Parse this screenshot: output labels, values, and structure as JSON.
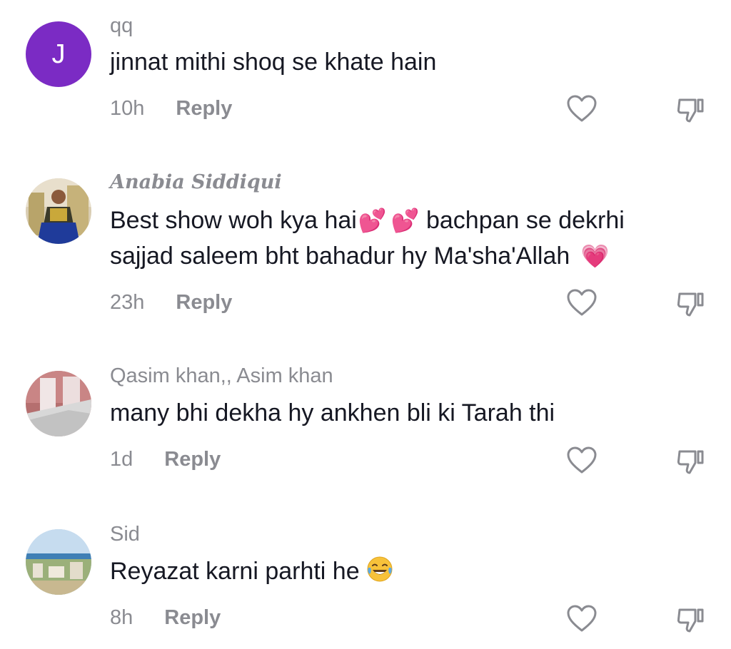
{
  "comments": [
    {
      "username": "qq",
      "avatar_letter": "J",
      "text": "jinnat mithi shoq se khate hain",
      "time": "10h",
      "reply_label": "Reply"
    },
    {
      "username": "Anabia Siddiqui",
      "text_part1": "Best show woh kya hai",
      "text_part2": "bachpan se dekrhi",
      "text_line2": "sajjad saleem bht bahadur hy Ma'sha'Allah",
      "time": "23h",
      "reply_label": "Reply"
    },
    {
      "username": "Qasim khan,, Asim khan",
      "text": "many bhi dekha hy ankhen bli ki Tarah thi",
      "time": "1d",
      "reply_label": "Reply"
    },
    {
      "username": "Sid",
      "text": "Reyazat karni parhti he",
      "time": "8h",
      "reply_label": "Reply"
    }
  ],
  "colors": {
    "avatar_purple": "#7b2bc4",
    "secondary_text": "#8a8b91",
    "primary_text": "#161823",
    "heart_emoji": "#ec3e8d"
  },
  "icons": {
    "like": "heart-outline-icon",
    "dislike": "thumbs-down-icon"
  }
}
